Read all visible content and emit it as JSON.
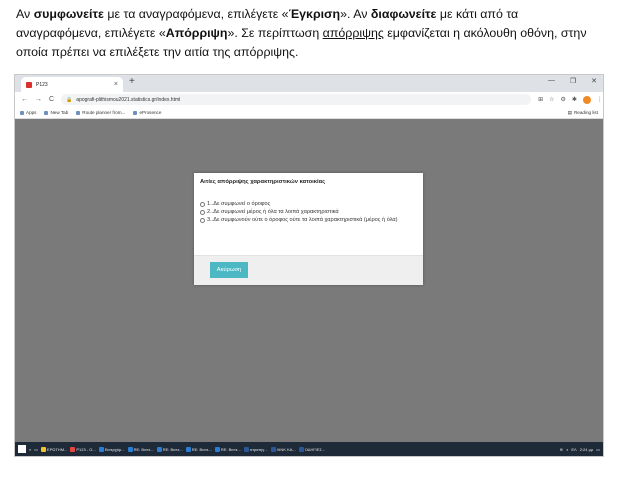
{
  "doc": {
    "seg1": "Αν ",
    "seg2": "συμφωνείτε",
    "seg3": " με τα αναγραφόμενα, επιλέγετε «",
    "seg4": "Έγκριση",
    "seg5": "». Αν ",
    "seg6": "διαφωνείτε",
    "seg7": " με κάτι από τα αναγραφόμενα, επιλέγετε «",
    "seg8": "Απόρριψη",
    "seg9": "». Σε περίπτωση ",
    "seg10": "απόρριψης",
    "seg11": " εμφανίζεται η ακόλουθη οθόνη, στην οποία πρέπει να επιλέξετε την αιτία της απόρριψης."
  },
  "browser": {
    "tab_title": "P123",
    "tab_close": "×",
    "new_tab": "+",
    "win_minimize": "—",
    "win_restore": "❐",
    "win_close": "✕",
    "nav_back": "←",
    "nav_forward": "→",
    "nav_reload": "C",
    "url": "apografi-plithismou2021.statistics.gr/index.html",
    "bookmarks": [
      "Apps",
      "New Tab",
      "Route planner from...",
      "eProsence"
    ],
    "reading_list": "Reading list"
  },
  "modal": {
    "title": "Αιτίες απόρριψης χαρακτηριστικών κατοικίας",
    "options": [
      "1..Δε συμφωνεί ο όροφος",
      "2..Δε συμφωνεί μέρος ή όλα τα λοιπά χαρακτηριστικά",
      "3..Δε συμφωνούν ούτε ο όροφος ούτε τα λοιπά χαρακτηριστικά (μέρος ή όλα)"
    ],
    "cancel_label": "Ακύρωση"
  },
  "taskbar": {
    "items": [
      "ΕΡΩΤΗΜ...",
      "P123 - G...",
      "Εισερχόμ...",
      "RE: Βιντε...",
      "RE: Βιντε...",
      "RE: Βιντε...",
      "RE: Βιντε...",
      "στρατηγ...",
      "ΛΙΝΚ ΚΑ...",
      "ΟΔΗΓΙΕΣ..."
    ],
    "lang": "ΕΛ",
    "time": "2:24 μμ"
  },
  "colors": {
    "accent": "#4cb8c4",
    "backdrop": "#7a7a7a",
    "taskbar": "#1e2a38",
    "favicon": "#d9302c"
  }
}
